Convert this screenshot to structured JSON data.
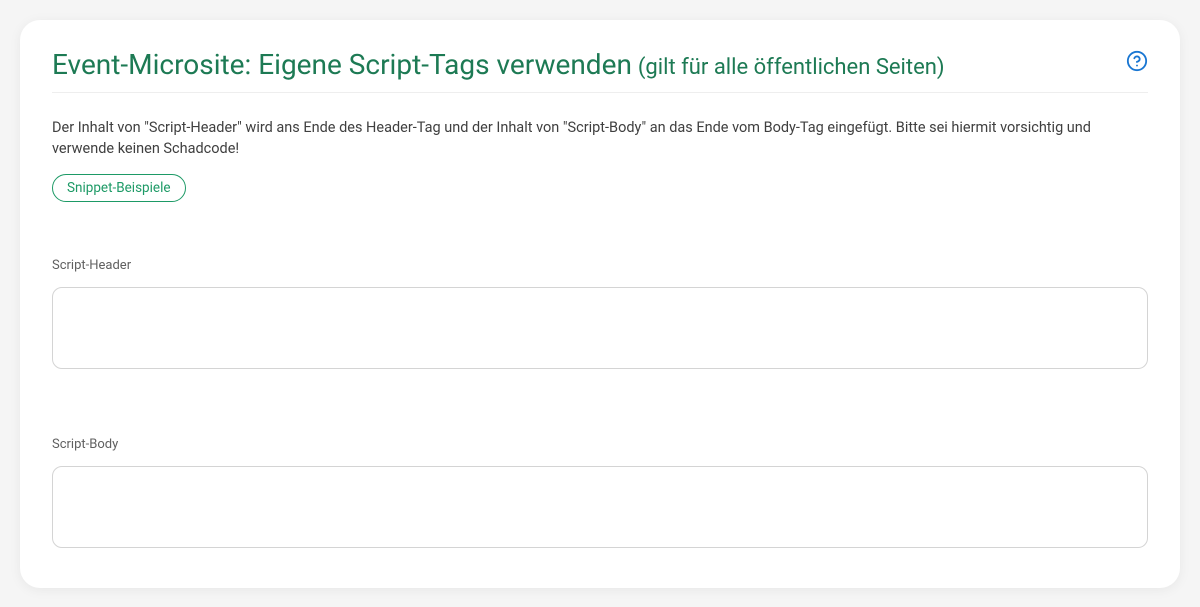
{
  "header": {
    "title_main": "Event-Microsite: Eigene Script-Tags verwenden",
    "title_sub": "(gilt für alle öffentlichen Seiten)"
  },
  "description": "Der Inhalt von \"Script-Header\" wird ans Ende des Header-Tag und der Inhalt von \"Script-Body\" an das Ende vom Body-Tag eingefügt. Bitte sei hiermit vorsichtig und verwende keinen Schadcode!",
  "snippet_button": "Snippet-Beispiele",
  "fields": {
    "script_header": {
      "label": "Script-Header",
      "value": ""
    },
    "script_body": {
      "label": "Script-Body",
      "value": ""
    }
  }
}
